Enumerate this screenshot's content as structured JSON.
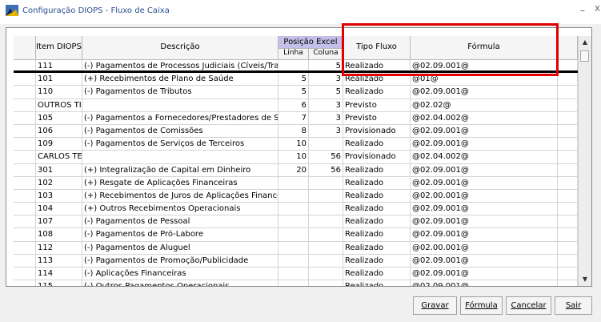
{
  "window": {
    "title": "Configuração DIOPS - Fluxo de Caixa",
    "minimize": "–",
    "close": "X"
  },
  "columns": {
    "item": "Item DIOPS",
    "descricao": "Descrição",
    "posicao": "Posição Excel",
    "linha": "Linha",
    "coluna": "Coluna",
    "tipo": "Tipo Fluxo",
    "formula": "Fórmula"
  },
  "rows": [
    {
      "item": "111",
      "descricao": "(-) Pagamentos de Processos Judiciais (Cíveis/Trabalhis",
      "linha": "",
      "coluna": "5",
      "tipo": "Realizado",
      "formula": "@02.09.001@",
      "selected": true
    },
    {
      "item": "101",
      "descricao": "(+) Recebimentos de Plano de Saúde",
      "linha": "5",
      "coluna": "3",
      "tipo": "Realizado",
      "formula": "@01@"
    },
    {
      "item": "110",
      "descricao": "(-) Pagamentos de Tributos",
      "linha": "5",
      "coluna": "5",
      "tipo": "Realizado",
      "formula": "@02.09.001@"
    },
    {
      "item": "OUTROS TIL",
      "descricao": "",
      "linha": "6",
      "coluna": "3",
      "tipo": "Previsto",
      "formula": "@02.02@"
    },
    {
      "item": "105",
      "descricao": "(-) Pagamentos a Fornecedores/Prestadores de Serviço",
      "linha": "7",
      "coluna": "3",
      "tipo": "Previsto",
      "formula": "@02.04.002@"
    },
    {
      "item": "106",
      "descricao": "(-) Pagamentos de Comissões",
      "linha": "8",
      "coluna": "3",
      "tipo": "Provisionado",
      "formula": "@02.09.001@"
    },
    {
      "item": "109",
      "descricao": "(-) Pagamentos de Serviços de Terceiros",
      "linha": "10",
      "coluna": "",
      "tipo": "Realizado",
      "formula": "@02.09.001@"
    },
    {
      "item": "CARLOS TES",
      "descricao": "",
      "linha": "10",
      "coluna": "56",
      "tipo": "Provisionado",
      "formula": "@02.04.002@"
    },
    {
      "item": "301",
      "descricao": "(+) Integralização de Capital em Dinheiro",
      "linha": "20",
      "coluna": "56",
      "tipo": "Realizado",
      "formula": "@02.09.001@"
    },
    {
      "item": "102",
      "descricao": "(+) Resgate de Aplicações Financeiras",
      "linha": "",
      "coluna": "",
      "tipo": "Realizado",
      "formula": "@02.09.001@"
    },
    {
      "item": "103",
      "descricao": "(+) Recebimentos de Juros de Aplicações Financeiras",
      "linha": "",
      "coluna": "",
      "tipo": "Realizado",
      "formula": "@02.00.001@"
    },
    {
      "item": "104",
      "descricao": "(+) Outros Recebimentos Operacionais",
      "linha": "",
      "coluna": "",
      "tipo": "Realizado",
      "formula": "@02.09.001@"
    },
    {
      "item": "107",
      "descricao": "(-) Pagamentos de Pessoal",
      "linha": "",
      "coluna": "",
      "tipo": "Realizado",
      "formula": "@02.09.001@"
    },
    {
      "item": "108",
      "descricao": "(-) Pagamentos de Pró-Labore",
      "linha": "",
      "coluna": "",
      "tipo": "Realizado",
      "formula": "@02.09.001@"
    },
    {
      "item": "112",
      "descricao": "(-) Pagamentos de Aluguel",
      "linha": "",
      "coluna": "",
      "tipo": "Realizado",
      "formula": "@02.00.001@"
    },
    {
      "item": "113",
      "descricao": "(-) Pagamentos de Promoção/Publicidade",
      "linha": "",
      "coluna": "",
      "tipo": "Realizado",
      "formula": "@02.09.001@"
    },
    {
      "item": "114",
      "descricao": "(-) Aplicações Financeiras",
      "linha": "",
      "coluna": "",
      "tipo": "Realizado",
      "formula": "@02.09.001@"
    },
    {
      "item": "115",
      "descricao": "(-) Outros Pagamentos Operacionais",
      "linha": "",
      "coluna": "",
      "tipo": "Realizado",
      "formula": "@02.09.001@"
    }
  ],
  "buttons": {
    "gravar": "Gravar",
    "formula": "Fórmula",
    "cancelar": "Cancelar",
    "sair": "Sair"
  },
  "scroll": {
    "up": "▲",
    "down": "▼"
  },
  "colors": {
    "highlight": "#e00000",
    "posicao_header": "#c3bfe8",
    "title_text": "#2a4f8f"
  }
}
